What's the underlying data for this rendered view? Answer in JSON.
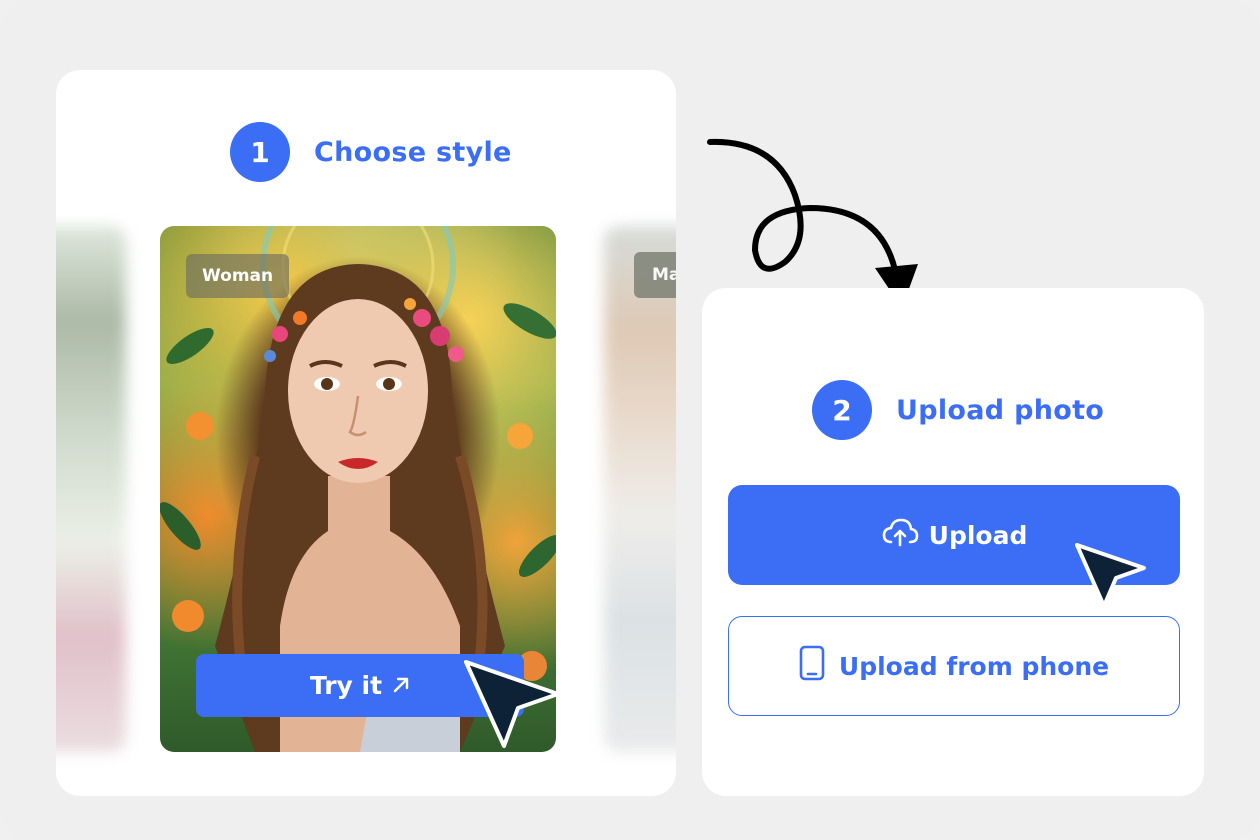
{
  "step1": {
    "number": "1",
    "title": "Choose style"
  },
  "style_card": {
    "tag": "Woman",
    "button_label": "Try it",
    "button_icon": "arrow-up-right-icon"
  },
  "side_card_right": {
    "tag": "Ma"
  },
  "step2": {
    "number": "2",
    "title": "Upload photo"
  },
  "upload": {
    "label": "Upload",
    "icon": "cloud-upload-icon"
  },
  "upload_phone": {
    "label": "Upload from phone",
    "icon": "phone-icon"
  },
  "colors": {
    "accent": "#3b6ef5",
    "background": "#efefef",
    "card": "#ffffff",
    "pointer": "#0d2236"
  }
}
